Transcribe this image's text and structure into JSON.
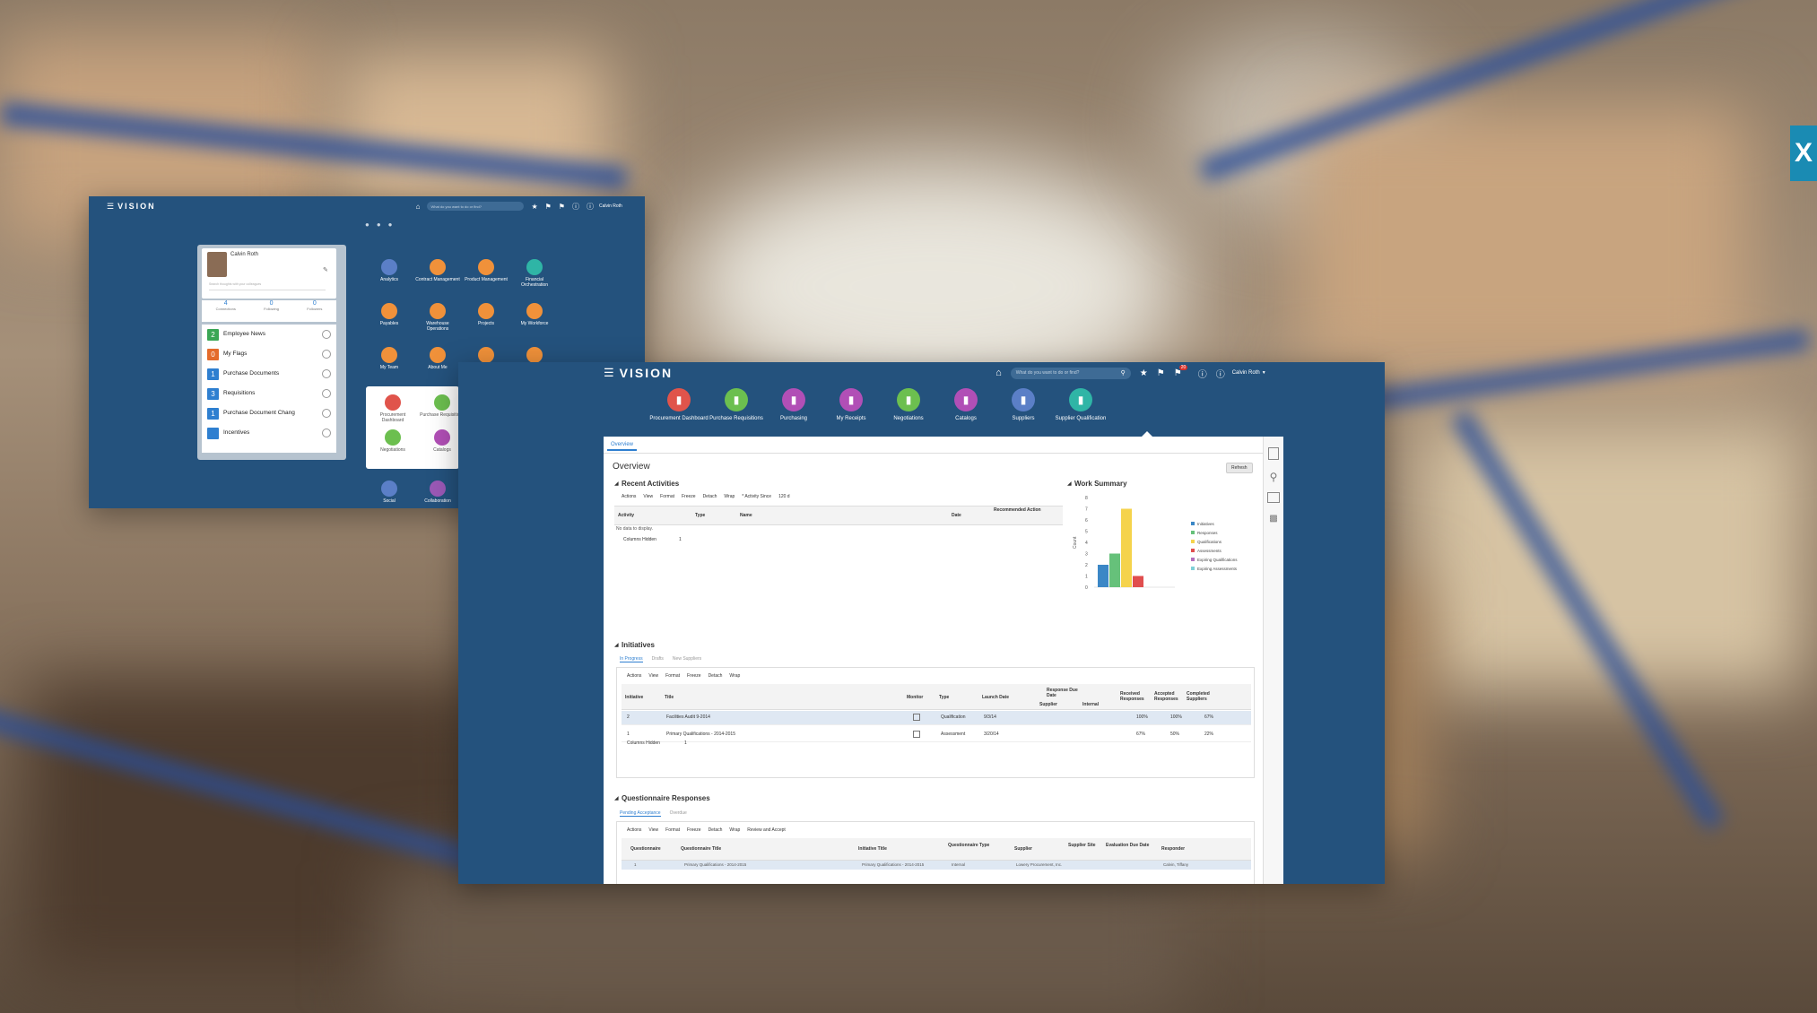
{
  "background": {
    "theme": "blurred warehouse shelving"
  },
  "edge_tab": {
    "label": "X"
  },
  "back_window": {
    "logo": "VISION",
    "search_placeholder": "What do you want to do or find?",
    "user": "Calvin Roth",
    "profile": {
      "name": "Calvin Roth",
      "placeholder": "Search thoughts with your colleagues",
      "stats": [
        {
          "value": "4",
          "label": "Connections"
        },
        {
          "value": "0",
          "label": "Following"
        },
        {
          "value": "0",
          "label": "Followers"
        }
      ],
      "list": [
        {
          "count": "2",
          "label": "Employee News",
          "color": "#3aa655"
        },
        {
          "count": "0",
          "label": "My Flags",
          "color": "#e46b2b"
        },
        {
          "count": "1",
          "label": "Purchase Documents",
          "color": "#2e7fd0"
        },
        {
          "count": "3",
          "label": "Requisitions",
          "color": "#2e7fd0"
        },
        {
          "count": "1",
          "label": "Purchase Document Chang",
          "color": "#2e7fd0"
        },
        {
          "count": "",
          "label": "Incentives",
          "color": "#2e7fd0"
        }
      ]
    },
    "tiles": [
      {
        "label": "Analytics",
        "color": "#5b7fc7",
        "icon": "chart-icon"
      },
      {
        "label": "Contract Management",
        "color": "#f0913a",
        "icon": "contract-icon"
      },
      {
        "label": "Product Management",
        "color": "#f0913a",
        "icon": "product-icon"
      },
      {
        "label": "Financial Orchestration",
        "color": "#2fb5a6",
        "icon": "finance-icon"
      },
      {
        "label": "Payables",
        "color": "#f0913a",
        "icon": "payables-icon"
      },
      {
        "label": "Warehouse Operations",
        "color": "#f0913a",
        "icon": "warehouse-icon"
      },
      {
        "label": "Projects",
        "color": "#f0913a",
        "icon": "projects-icon"
      },
      {
        "label": "My Workforce",
        "color": "#f0913a",
        "icon": "workforce-icon"
      },
      {
        "label": "My Team",
        "color": "#f0913a",
        "icon": "team-icon"
      },
      {
        "label": "About Me",
        "color": "#f0913a",
        "icon": "aboutme-icon"
      },
      {
        "label": "",
        "color": "#f0913a",
        "icon": "tile-icon"
      },
      {
        "label": "",
        "color": "#f0913a",
        "icon": "tile-icon"
      },
      {
        "label": "Social",
        "color": "#5b7fc7",
        "icon": "social-icon"
      },
      {
        "label": "Collaboration",
        "color": "#9b59b6",
        "icon": "collab-icon"
      }
    ],
    "popup_tiles": [
      {
        "label": "Procurement Dashboard",
        "color": "#e0544b"
      },
      {
        "label": "Purchase Requisitions",
        "color": "#6cbf4f"
      },
      {
        "label": "Negotiations",
        "color": "#6cbf4f"
      },
      {
        "label": "Catalogs",
        "color": "#b14fb6"
      }
    ]
  },
  "front_window": {
    "logo": "VISION",
    "search_placeholder": "What do you want to do or find?",
    "notif_count": "20",
    "user": "Calvin Roth",
    "nav": [
      {
        "label": "Procurement Dashboard",
        "color": "#e0544b"
      },
      {
        "label": "Purchase Requisitions",
        "color": "#6cbf4f"
      },
      {
        "label": "Purchasing",
        "color": "#b14fb6"
      },
      {
        "label": "My Receipts",
        "color": "#b14fb6"
      },
      {
        "label": "Negotiations",
        "color": "#6cbf4f"
      },
      {
        "label": "Catalogs",
        "color": "#b14fb6"
      },
      {
        "label": "Suppliers",
        "color": "#5b7fc7"
      },
      {
        "label": "Supplier Qualification",
        "color": "#2fb5a6"
      }
    ],
    "panel": {
      "tab": "Overview",
      "title": "Overview",
      "refresh": "Refresh",
      "recent": {
        "title": "Recent Activities",
        "toolbar": [
          "Actions",
          "View",
          "Format",
          "Freeze",
          "Detach",
          "Wrap",
          "* Activity Since",
          "120 d"
        ],
        "columns": [
          "Activity",
          "Type",
          "Name",
          "Date",
          "Recommended Action"
        ],
        "empty": "No data to display.",
        "hidden_label": "Columns Hidden",
        "hidden_count": "1"
      },
      "work_summary": {
        "title": "Work Summary",
        "ylabel": "Count"
      },
      "initiatives": {
        "title": "Initiatives",
        "tabs": [
          "In Progress",
          "Drafts",
          "New Suppliers"
        ],
        "toolbar": [
          "Actions",
          "View",
          "Format",
          "Freeze",
          "Detach",
          "Wrap"
        ],
        "columns": [
          "Initiative",
          "Title",
          "Monitor",
          "Type",
          "Launch Date",
          "Response Due Date",
          "Supplier",
          "Internal",
          "Received Responses",
          "Accepted Responses",
          "Completed Suppliers"
        ],
        "rows": [
          {
            "id": "2",
            "title": "Facilities Audit 9-2014",
            "type": "Qualification",
            "date": "9/3/14",
            "received": "100%",
            "accepted": "100%",
            "completed": "67%"
          },
          {
            "id": "1",
            "title": "Primary Qualifications - 2014-2015",
            "type": "Assessment",
            "date": "3/20/14",
            "received": "67%",
            "accepted": "50%",
            "completed": "22%"
          }
        ],
        "hidden_label": "Columns Hidden",
        "hidden_count": "1"
      },
      "questionnaire": {
        "title": "Questionnaire Responses",
        "tabs": [
          "Pending Acceptance",
          "Overdue"
        ],
        "toolbar": [
          "Actions",
          "View",
          "Format",
          "Freeze",
          "Detach",
          "Wrap",
          "Review and Accept"
        ],
        "columns": [
          "Questionnaire",
          "Questionnaire Title",
          "Initiative Title",
          "Questionnaire Type",
          "Supplier",
          "Supplier Site",
          "Evaluation Due Date",
          "Responder"
        ],
        "row": [
          "1",
          "Primary Qualifications - 2014-2015",
          "Primary Qualifications - 2014-2015",
          "Internal",
          "Lowery Procurement, Inc.",
          "",
          "",
          "Calvin, Tiffany"
        ]
      }
    }
  },
  "chart_data": {
    "type": "bar",
    "categories": [
      "Initiatives",
      "Responses",
      "Qualifications",
      "Assessments",
      "Expiring Qualifications",
      "Expiring Assessments"
    ],
    "values": [
      2,
      3,
      7,
      1,
      0,
      0
    ],
    "ylim": [
      0,
      8
    ],
    "yticks": [
      "0",
      "1",
      "2",
      "3",
      "4",
      "5",
      "6",
      "7",
      "8"
    ],
    "colors": [
      "#3b87c6",
      "#66c17a",
      "#f5d34c",
      "#e04e4e",
      "#b36fbd",
      "#7fd0d7"
    ],
    "legend": "right",
    "ylabel": "Count"
  }
}
